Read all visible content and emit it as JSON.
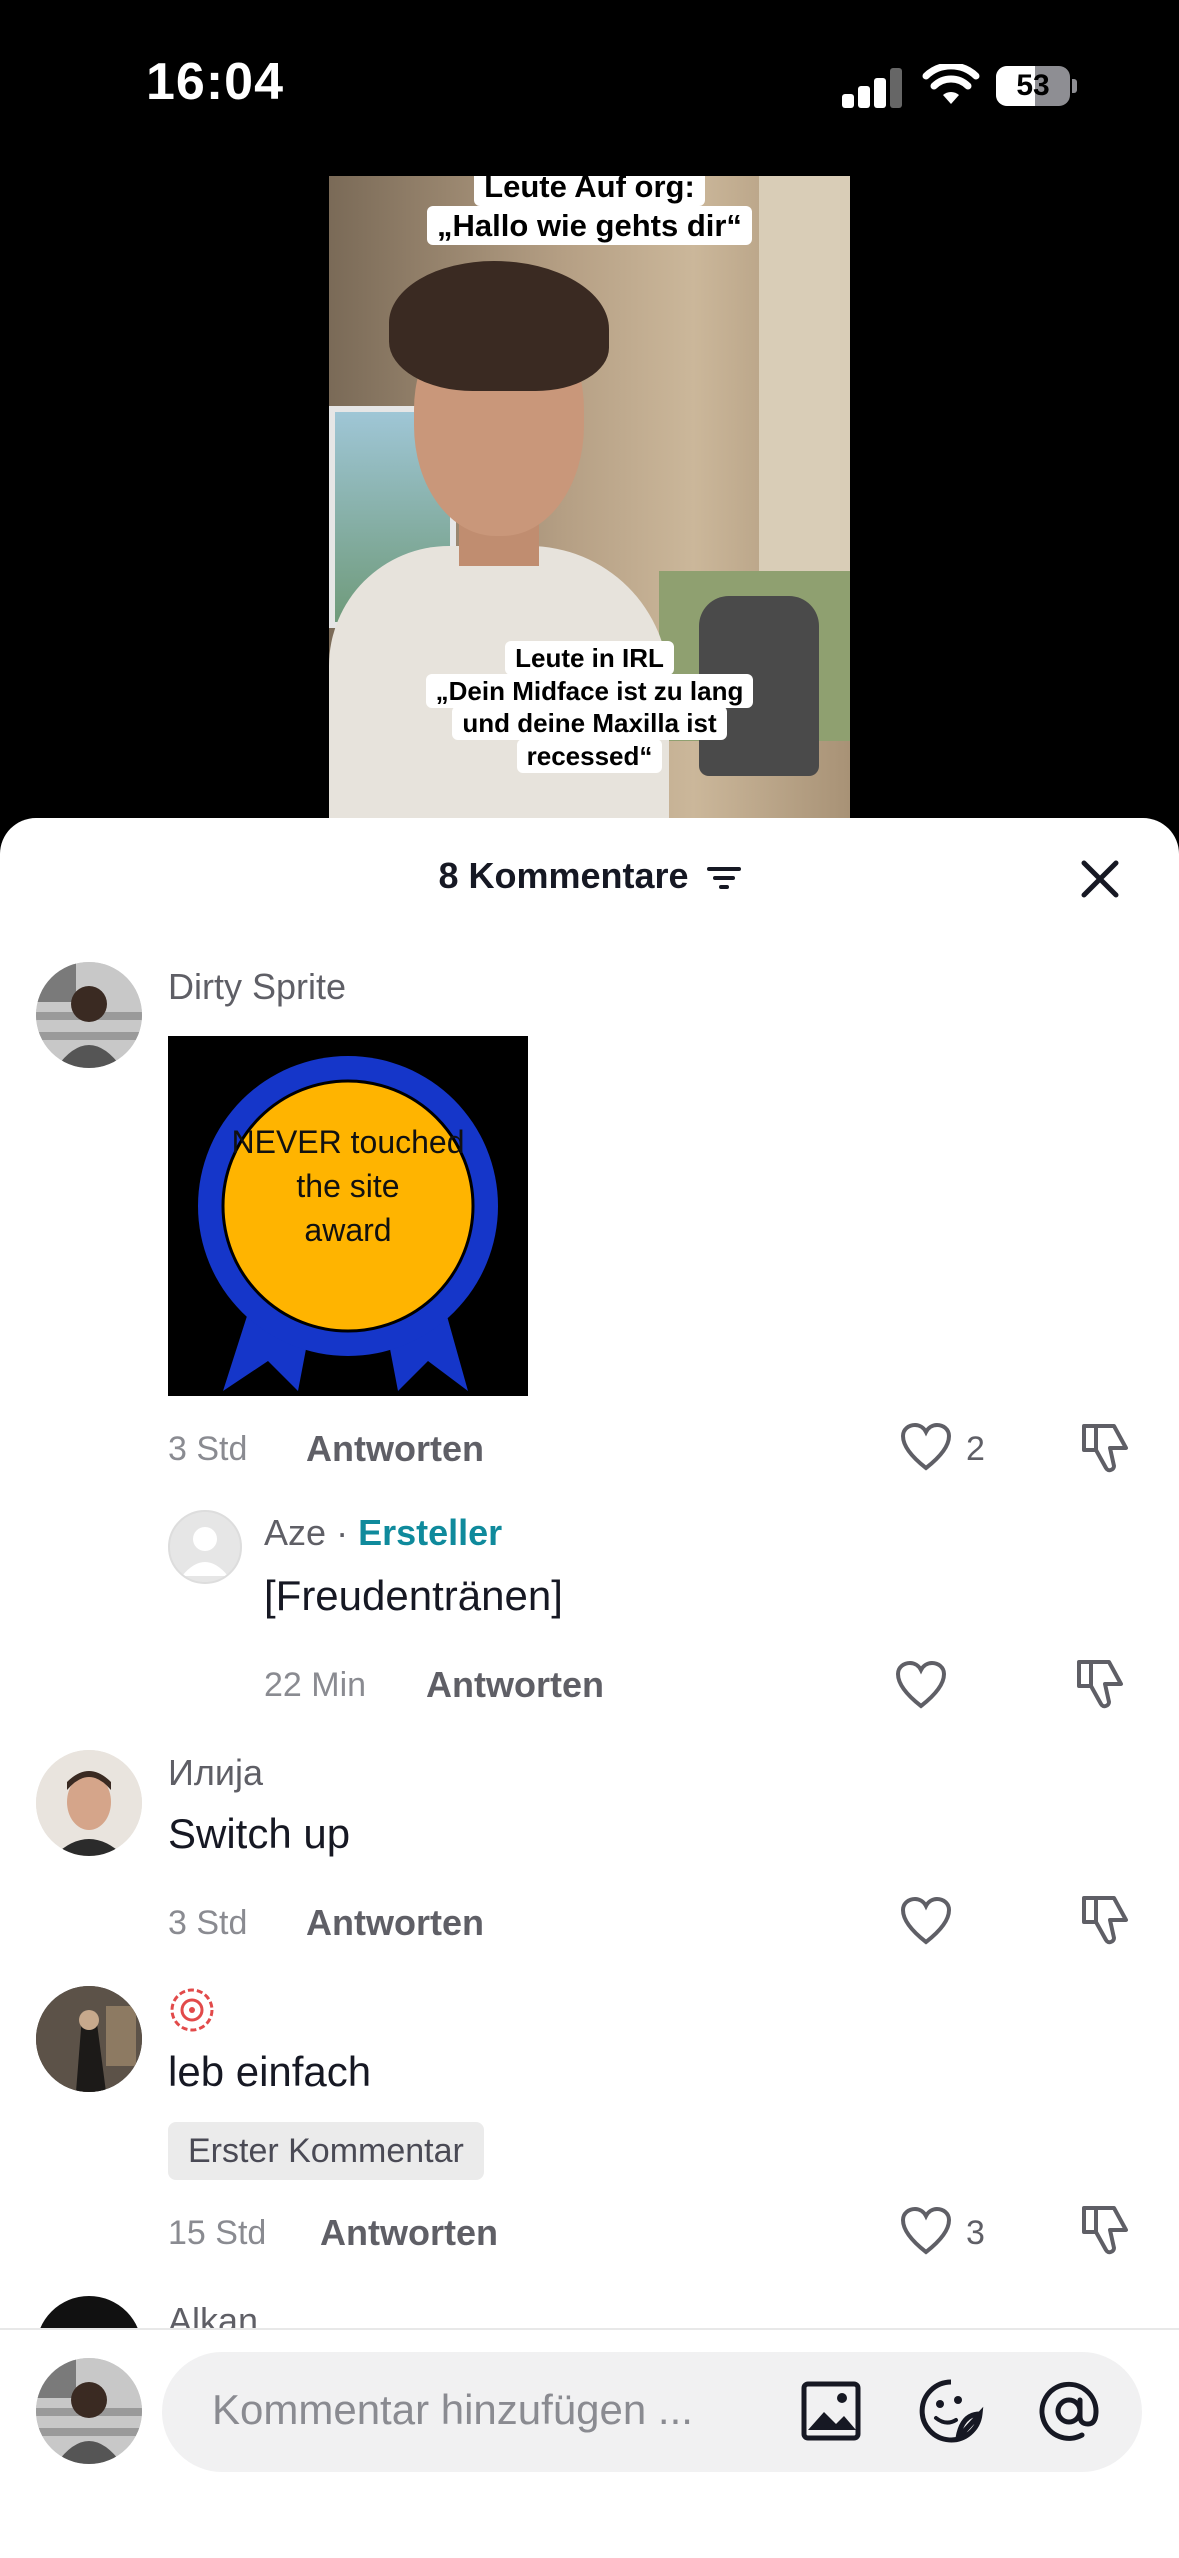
{
  "status_bar": {
    "time": "16:04",
    "battery": "53",
    "battery_level": 0.53
  },
  "video": {
    "caption_top": [
      "Leute Auf org:",
      "„Hallo wie gehts dir“"
    ],
    "caption_bottom": [
      "Leute in IRL",
      "„Dein Midface ist zu lang",
      "und deine Maxilla ist",
      "recessed“"
    ]
  },
  "comments_header": {
    "title": "8 Kommentare"
  },
  "comments": [
    {
      "username": "Dirty Sprite",
      "sticker_text": [
        "NEVER touched",
        "the site",
        "award"
      ],
      "time": "3 Std",
      "reply_label": "Antworten",
      "likes": "2",
      "replies": [
        {
          "username": "Aze",
          "separator": "·",
          "creator_label": "Ersteller",
          "text": "[Freudentränen]",
          "time": "22 Min",
          "reply_label": "Antworten",
          "likes": ""
        }
      ]
    },
    {
      "username": "Илија",
      "text": "Switch up",
      "time": "3 Std",
      "reply_label": "Antworten",
      "likes": ""
    },
    {
      "username": "",
      "text": "leb einfach",
      "badge": "Erster Kommentar",
      "time": "15 Std",
      "reply_label": "Antworten",
      "likes": "3"
    },
    {
      "username": "Alkan"
    }
  ],
  "composer": {
    "placeholder": "Kommentar hinzufügen ..."
  },
  "icons": {
    "sort": "sort-icon",
    "close": "close-icon",
    "like": "heart-icon",
    "dislike": "thumbs-down-icon",
    "image": "image-icon",
    "emoji": "emoji-icon",
    "mention": "at-icon"
  },
  "colors": {
    "creator": "#0f8a9c",
    "award_ribbon": "#1536c9",
    "award_medal": "#ffb400"
  }
}
